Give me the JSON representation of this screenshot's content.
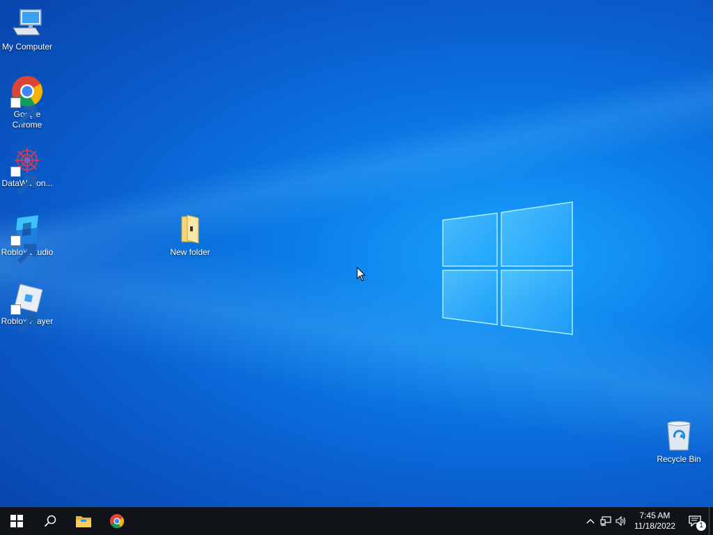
{
  "desktop": {
    "icons": [
      {
        "label": "My Computer",
        "icon": "computer-icon",
        "shortcut": false
      },
      {
        "label": "Google Chrome",
        "icon": "chrome-icon",
        "shortcut": true
      },
      {
        "label": "DataWagon...",
        "icon": "datawagon-icon",
        "shortcut": true
      },
      {
        "label": "Roblox Studio",
        "icon": "roblox-studio-icon",
        "shortcut": true
      },
      {
        "label": "Roblox Player",
        "icon": "roblox-player-icon",
        "shortcut": true
      },
      {
        "label": "New folder",
        "icon": "folder-icon",
        "shortcut": false
      },
      {
        "label": "Recycle Bin",
        "icon": "recycle-bin-icon",
        "shortcut": false
      }
    ]
  },
  "taskbar": {
    "buttons": [
      {
        "name": "start",
        "icon": "windows-logo-icon"
      },
      {
        "name": "search",
        "icon": "search-icon"
      },
      {
        "name": "file-explorer",
        "icon": "file-explorer-icon"
      },
      {
        "name": "chrome",
        "icon": "chrome-icon"
      }
    ],
    "tray": {
      "icons": [
        "chevron-up-icon",
        "network-icon",
        "volume-icon"
      ],
      "time": "7:45 AM",
      "date": "11/18/2022",
      "notifications_count": "1"
    },
    "colors": {
      "background": "#101418",
      "wallpaper_accent": "#0b7de8"
    }
  }
}
